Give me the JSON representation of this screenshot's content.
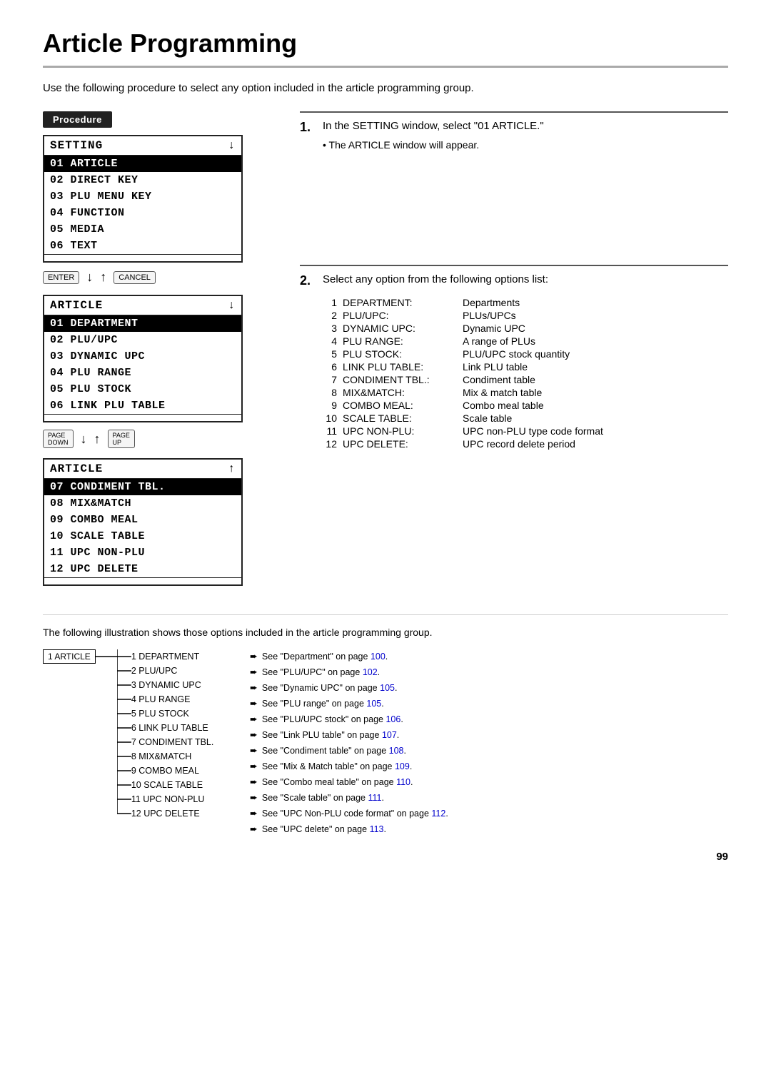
{
  "page": {
    "title": "Article Programming",
    "intro": "Use the following procedure to select any option included in the article programming group.",
    "page_number": "99"
  },
  "procedure_badge": "Procedure",
  "setting_menu": {
    "title": "SETTING",
    "title_arrow": "↓",
    "items": [
      {
        "num": "01",
        "label": "ARTICLE",
        "selected": true
      },
      {
        "num": "02",
        "label": "DIRECT KEY",
        "selected": false
      },
      {
        "num": "03",
        "label": "PLU MENU KEY",
        "selected": false
      },
      {
        "num": "04",
        "label": "FUNCTION",
        "selected": false
      },
      {
        "num": "05",
        "label": "MEDIA",
        "selected": false
      },
      {
        "num": "06",
        "label": "TEXT",
        "selected": false
      }
    ]
  },
  "nav1": {
    "enter": "ENTER",
    "down": "↓",
    "up": "↑",
    "cancel": "CANCEL"
  },
  "article_menu1": {
    "title": "ARTICLE",
    "title_arrow": "↓",
    "items": [
      {
        "num": "01",
        "label": "DEPARTMENT",
        "selected": true
      },
      {
        "num": "02",
        "label": "PLU/UPC",
        "selected": false
      },
      {
        "num": "03",
        "label": "DYNAMIC UPC",
        "selected": false
      },
      {
        "num": "04",
        "label": "PLU RANGE",
        "selected": false
      },
      {
        "num": "05",
        "label": "PLU STOCK",
        "selected": false
      },
      {
        "num": "06",
        "label": "LINK PLU TABLE",
        "selected": false
      }
    ]
  },
  "nav2": {
    "page_down": "PAGE DOWN",
    "down": "↓",
    "up": "↑",
    "page_up": "PAGE UP"
  },
  "article_menu2": {
    "title": "ARTICLE",
    "title_arrow": "↑",
    "items": [
      {
        "num": "07",
        "label": "CONDIMENT TBL.",
        "selected": true
      },
      {
        "num": "08",
        "label": "MIX&MATCH",
        "selected": false
      },
      {
        "num": "09",
        "label": "COMBO MEAL",
        "selected": false
      },
      {
        "num": "10",
        "label": "SCALE TABLE",
        "selected": false
      },
      {
        "num": "11",
        "label": "UPC NON-PLU",
        "selected": false
      },
      {
        "num": "12",
        "label": "UPC DELETE",
        "selected": false
      }
    ]
  },
  "step1": {
    "number": "1.",
    "text": "In the SETTING window, select \"01 ARTICLE.\"",
    "sub": "• The ARTICLE window will appear."
  },
  "step2": {
    "number": "2.",
    "text": "Select any option from the following options list:",
    "options": [
      {
        "num": "1",
        "key": "DEPARTMENT:",
        "val": "Departments"
      },
      {
        "num": "2",
        "key": "PLU/UPC:",
        "val": "PLUs/UPCs"
      },
      {
        "num": "3",
        "key": "DYNAMIC UPC:",
        "val": "Dynamic UPC"
      },
      {
        "num": "4",
        "key": "PLU RANGE:",
        "val": "A range of PLUs"
      },
      {
        "num": "5",
        "key": "PLU STOCK:",
        "val": "PLU/UPC stock quantity"
      },
      {
        "num": "6",
        "key": "LINK PLU TABLE:",
        "val": "Link PLU table"
      },
      {
        "num": "7",
        "key": "CONDIMENT TBL.:",
        "val": "Condiment table"
      },
      {
        "num": "8",
        "key": "MIX&MATCH:",
        "val": "Mix & match table"
      },
      {
        "num": "9",
        "key": "COMBO MEAL:",
        "val": "Combo meal table"
      },
      {
        "num": "10",
        "key": "SCALE TABLE:",
        "val": "Scale table"
      },
      {
        "num": "11",
        "key": "UPC NON-PLU:",
        "val": "UPC non-PLU type code format"
      },
      {
        "num": "12",
        "key": "UPC DELETE:",
        "val": "UPC record delete period"
      }
    ]
  },
  "illustration": {
    "text": "The following illustration shows those options included in the article programming group.",
    "root_label": "1 ARTICLE",
    "tree_items": [
      "1 DEPARTMENT",
      "2 PLU/UPC",
      "3 DYNAMIC UPC",
      "4 PLU RANGE",
      "5 PLU STOCK",
      "6 LINK PLU TABLE",
      "7 CONDIMENT TBL.",
      "8 MIX&MATCH",
      "9 COMBO MEAL",
      "10 SCALE TABLE",
      "11 UPC NON-PLU",
      "12 UPC DELETE"
    ],
    "links": [
      {
        "text": "See \"Department\" on page ",
        "page": "100",
        "href": "#"
      },
      {
        "text": "See \"PLU/UPC\" on page ",
        "page": "102",
        "href": "#"
      },
      {
        "text": "See \"Dynamic UPC\" on page ",
        "page": "105",
        "href": "#"
      },
      {
        "text": "See \"PLU range\" on page ",
        "page": "105",
        "href": "#"
      },
      {
        "text": "See \"PLU/UPC stock\" on page ",
        "page": "106",
        "href": "#"
      },
      {
        "text": "See \"Link PLU table\" on page ",
        "page": "107",
        "href": "#"
      },
      {
        "text": "See \"Condiment table\" on page ",
        "page": "108",
        "href": "#"
      },
      {
        "text": "See \"Mix & Match table\" on page ",
        "page": "109",
        "href": "#"
      },
      {
        "text": "See \"Combo meal table\" on page ",
        "page": "110",
        "href": "#"
      },
      {
        "text": "See \"Scale table\" on page ",
        "page": "111",
        "href": "#"
      },
      {
        "text": "See \"UPC Non-PLU code format\" on page ",
        "page": "112",
        "href": "#"
      },
      {
        "text": "See \"UPC delete\" on page ",
        "page": "113",
        "href": "#"
      }
    ]
  }
}
